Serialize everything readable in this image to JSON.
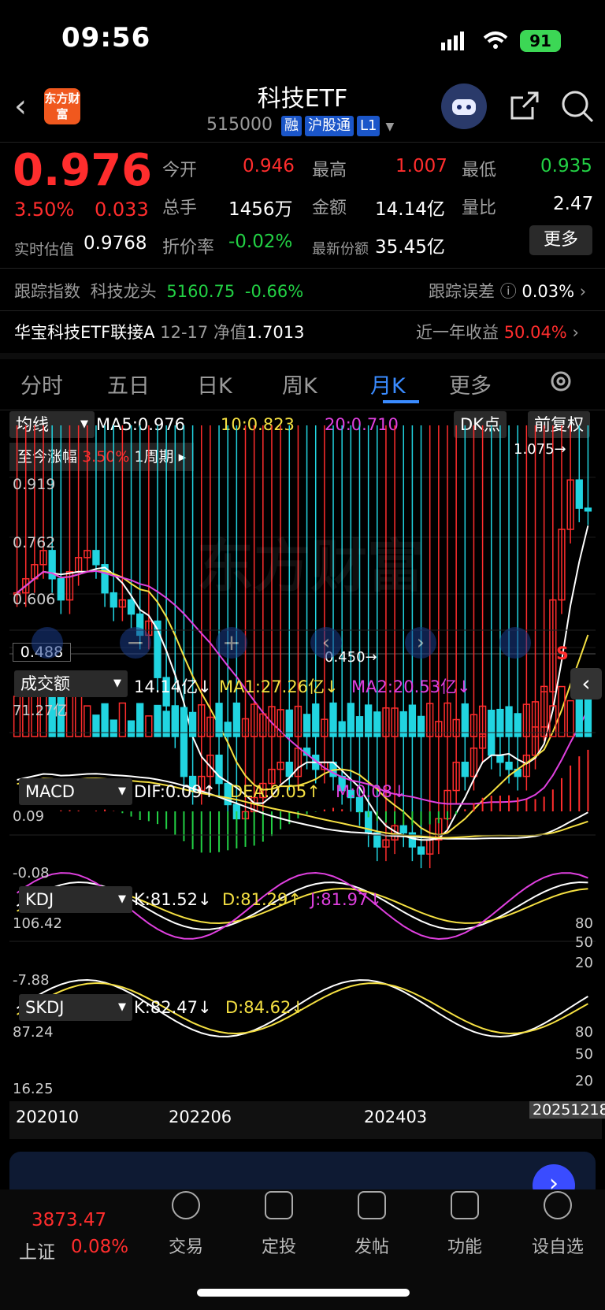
{
  "status": {
    "time": "09:56",
    "battery": "91"
  },
  "header": {
    "title": "科技ETF",
    "code": "515000",
    "tags": [
      "融",
      "沪股通",
      "L1"
    ],
    "logo": "东方财富"
  },
  "quote": {
    "price": "0.976",
    "pct": "3.50%",
    "chg": "0.033",
    "est_label": "实时估值",
    "est_value": "0.9768",
    "open_label": "今开",
    "open": "0.946",
    "high_label": "最高",
    "high": "1.007",
    "low_label": "最低",
    "low": "0.935",
    "vol_label": "总手",
    "vol": "1456万",
    "amt_label": "金额",
    "amt": "14.14亿",
    "ratio_label": "量比",
    "ratio": "2.47",
    "disc_label": "折价率",
    "disc": "-0.02%",
    "share_label": "最新份额",
    "share": "35.45亿",
    "more": "更多"
  },
  "track": {
    "label": "跟踪指数",
    "name": "科技龙头",
    "value": "5160.75",
    "pct": "-0.66%",
    "err_label": "跟踪误差",
    "err": "0.03%"
  },
  "link": {
    "name": "华宝科技ETF联接A",
    "date": "12-17",
    "nav_label": "净值",
    "nav": "1.7013",
    "ret_label": "近一年收益",
    "ret": "50.04%"
  },
  "tabs": [
    "分时",
    "五日",
    "日K",
    "周K",
    "月K",
    "更多"
  ],
  "ma": {
    "selector": "均线",
    "ma5": "MA5:0.976",
    "ma10": "10:0.823",
    "ma20": "20:0.710",
    "dk": "DK点",
    "adj": "前复权"
  },
  "range": {
    "label": "至今涨幅",
    "pct": "3.50%",
    "period": "1周期"
  },
  "kline": {
    "max_label": "1.075",
    "min_label": "0.450",
    "y_labels": [
      "0.919",
      "0.762",
      "0.606",
      "0.488"
    ],
    "watermark": "东方财富",
    "signal": "S"
  },
  "volume": {
    "selector": "成交额",
    "val": "14.14亿",
    "ma1": "MA1:27.26亿",
    "ma2": "MA2:20.53亿",
    "max": "71.27亿"
  },
  "macd": {
    "selector": "MACD",
    "dif": "DIF:0.09",
    "dea": "DEA:0.05",
    "m": "M:0.08",
    "top": "0.09",
    "bottom": "-0.08"
  },
  "kdj": {
    "selector": "KDJ",
    "k": "K:81.52",
    "d": "D:81.29",
    "j": "J:81.97",
    "top": "106.42",
    "bottom": "-7.88",
    "levels": [
      "80",
      "50",
      "20"
    ]
  },
  "skdj": {
    "selector": "SKDJ",
    "k": "K:82.47",
    "d": "D:84.62",
    "top": "87.24",
    "bottom": "16.25",
    "levels": [
      "80",
      "50",
      "20"
    ]
  },
  "xaxis": [
    "202010",
    "202206",
    "202403",
    "20251218"
  ],
  "nav": {
    "index_value": "3873.47",
    "index_name": "上证",
    "index_pct": "0.08%",
    "items": [
      "交易",
      "定投",
      "发帖",
      "功能",
      "设自选"
    ]
  },
  "chart_data": {
    "type": "candlestick",
    "x_ticks": [
      "202010",
      "202206",
      "202403",
      "20251218"
    ],
    "y_ticks": [
      0.919,
      0.762,
      0.606,
      0.488
    ],
    "max": 1.075,
    "min": 0.45,
    "closes": [
      0.86,
      0.88,
      0.9,
      0.92,
      0.88,
      0.85,
      0.89,
      0.91,
      0.92,
      0.9,
      0.86,
      0.84,
      0.85,
      0.83,
      0.8,
      0.82,
      0.74,
      0.7,
      0.66,
      0.6,
      0.58,
      0.6,
      0.63,
      0.59,
      0.56,
      0.54,
      0.55,
      0.57,
      0.59,
      0.61,
      0.62,
      0.6,
      0.64,
      0.63,
      0.61,
      0.62,
      0.6,
      0.58,
      0.57,
      0.55,
      0.52,
      0.5,
      0.51,
      0.53,
      0.52,
      0.5,
      0.49,
      0.51,
      0.54,
      0.58,
      0.62,
      0.6,
      0.64,
      0.66,
      0.63,
      0.62,
      0.61,
      0.6,
      0.63,
      0.67,
      0.72,
      0.85,
      0.95,
      1.02,
      0.98,
      0.976
    ]
  }
}
